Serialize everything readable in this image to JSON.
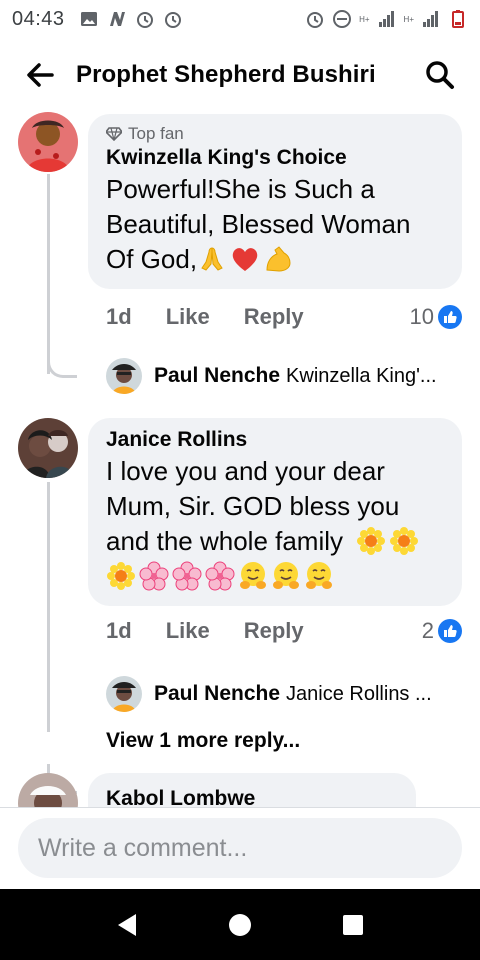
{
  "status_bar": {
    "time": "04:43",
    "network_1": "H+",
    "network_2": "H+"
  },
  "header": {
    "title": "Prophet Shepherd Bushiri"
  },
  "comments": [
    {
      "badge": "Top fan",
      "author": "Kwinzella King's Choice",
      "text": "Powerful!She is Such a Beautiful, Blessed Woman Of God,",
      "emojis": [
        "folded-hands",
        "red-heart",
        "flexed-biceps"
      ],
      "time": "1d",
      "like_label": "Like",
      "reply_label": "Reply",
      "reaction_count": "10",
      "reply": {
        "author": "Paul Nenche",
        "preview": "Kwinzella King'..."
      }
    },
    {
      "author": "Janice Rollins",
      "text_line1": "I love you and your dear",
      "text_line2": "Mum, Sir. GOD bless you",
      "text_line3": "and the whole family",
      "emojis_line3": [
        "sunflower",
        "sunflower"
      ],
      "emojis_line4": [
        "sunflower",
        "cherry-blossom",
        "cherry-blossom",
        "cherry-blossom",
        "hugging-face",
        "hugging-face",
        "hugging-face"
      ],
      "time": "1d",
      "like_label": "Like",
      "reply_label": "Reply",
      "reaction_count": "2",
      "reply": {
        "author": "Paul Nenche",
        "preview": "Janice Rollins ..."
      },
      "more_replies": "View 1 more reply..."
    },
    {
      "author": "Kabol Lombwe"
    }
  ],
  "composer": {
    "placeholder": "Write a comment..."
  },
  "colors": {
    "accent": "#1877f2",
    "bubble": "#f0f2f5",
    "secondary_text": "#65676b"
  }
}
